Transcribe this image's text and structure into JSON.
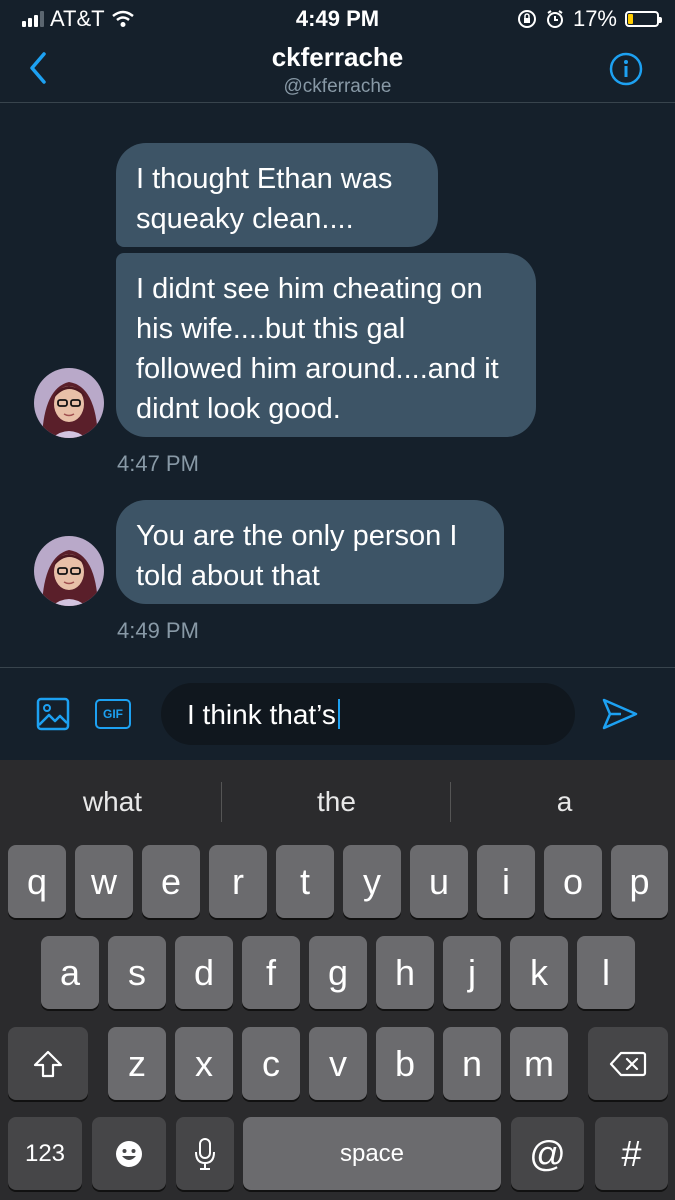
{
  "status_bar": {
    "carrier": "AT&T",
    "time": "4:49 PM",
    "battery_percent": "17%",
    "battery_level": 0.17
  },
  "header": {
    "title": "ckferrache",
    "handle": "@ckferrache"
  },
  "messages": [
    {
      "text": "I thought Ethan was squeaky clean...."
    },
    {
      "text": "I didnt see him cheating on his wife....but this gal followed him around....and it didnt look good."
    },
    {
      "text": "You are the only person I told about that"
    }
  ],
  "timestamps": [
    "4:47 PM",
    "4:49 PM"
  ],
  "composer": {
    "gif_label": "GIF",
    "input_value": "I think that’s"
  },
  "keyboard": {
    "suggestions": [
      "what",
      "the",
      "a"
    ],
    "row1": [
      "q",
      "w",
      "e",
      "r",
      "t",
      "y",
      "u",
      "i",
      "o",
      "p"
    ],
    "row2": [
      "a",
      "s",
      "d",
      "f",
      "g",
      "h",
      "j",
      "k",
      "l"
    ],
    "row3": [
      "z",
      "x",
      "c",
      "v",
      "b",
      "n",
      "m"
    ],
    "numbers_label": "123",
    "space_label": "space",
    "at_label": "@",
    "hash_label": "#"
  },
  "colors": {
    "background": "#15202b",
    "bubble": "#3d5466",
    "accent": "#1da1f2",
    "secondary_text": "#8899a6"
  }
}
